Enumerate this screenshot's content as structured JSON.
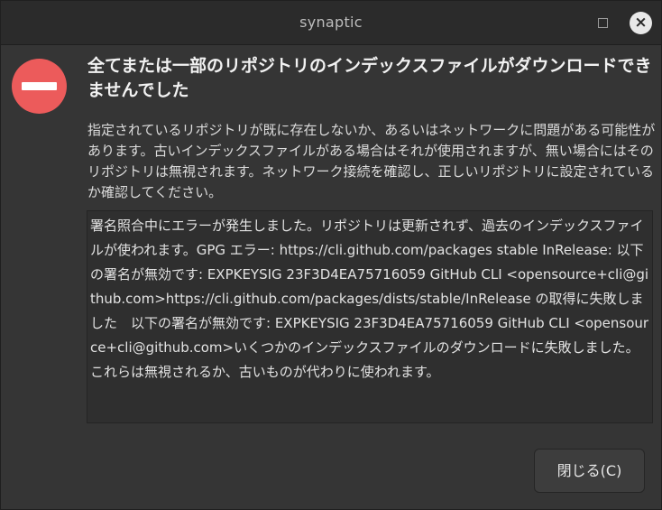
{
  "window": {
    "title": "synaptic",
    "close_glyph": "×"
  },
  "dialog": {
    "icon": "error-icon",
    "headline": "全てまたは一部のリポジトリのインデックスファイルがダウンロードできませんでした",
    "description": "指定されているリポジトリが既に存在しないか、あるいはネットワークに問題がある可能性があります。古いインデックスファイルがある場合はそれが使用されますが、無い場合にはそのリポジトリは無視されます。ネットワーク接続を確認し、正しいリポジトリに設定されているか確認してください。",
    "details": "署名照合中にエラーが発生しました。リポジトリは更新されず、過去のインデックスファイルが使われます。GPG エラー: https://cli.github.com/packages stable InRelease: 以下の署名が無効です: EXPKEYSIG 23F3D4EA75716059 GitHub CLI <opensource+cli@github.com>https://cli.github.com/packages/dists/stable/InRelease の取得に失敗しました　以下の署名が無効です: EXPKEYSIG 23F3D4EA75716059 GitHub CLI <opensource+cli@github.com>いくつかのインデックスファイルのダウンロードに失敗しました。これらは無視されるか、古いものが代わりに使われます。",
    "close_button_label": "閉じる(C)"
  },
  "colors": {
    "error_icon": "#ec5b5b",
    "window_bg": "#353535",
    "titlebar_bg": "#2b2b2b"
  }
}
